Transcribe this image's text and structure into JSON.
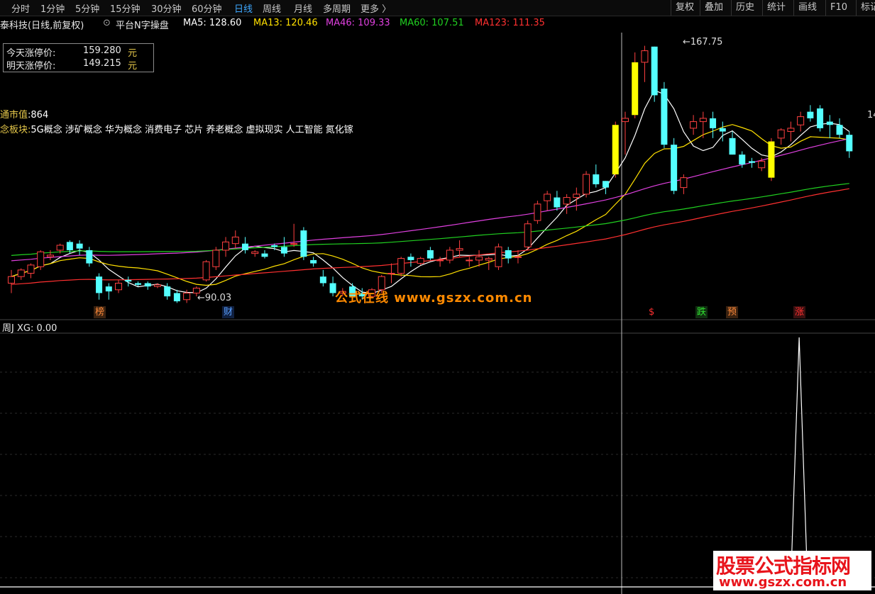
{
  "toolbar": {
    "periods": [
      "分时",
      "1分钟",
      "5分钟",
      "15分钟",
      "30分钟",
      "60分钟",
      "日线",
      "周线",
      "月线",
      "多周期",
      "更多 〉"
    ],
    "active_period": "日线",
    "tools": [
      "复权",
      "叠加",
      "历史",
      "统计",
      "画线",
      "F10",
      "标记"
    ]
  },
  "info": {
    "stock": "泰科技(日线,前复权)",
    "indicator": "平台N字操盘",
    "ma": [
      {
        "label": "MA5: 128.60",
        "color": "#ffffff"
      },
      {
        "label": "MA13: 120.46",
        "color": "#ffe000"
      },
      {
        "label": "MA46: 109.33",
        "color": "#e040e0"
      },
      {
        "label": "MA60: 107.51",
        "color": "#20d020"
      },
      {
        "label": "MA123: 111.35",
        "color": "#ff3030"
      }
    ]
  },
  "limits": {
    "today_label": "今天涨停价:",
    "today_value": "159.280",
    "tomorrow_label": "明天涨停价:",
    "tomorrow_value": "149.215",
    "unit": "元"
  },
  "notes": {
    "market_cap_label": "通市值",
    "market_cap_value": ":864",
    "concept_label": "念板块:",
    "concepts": "5G概念 涉矿概念 华为概念 消费电子 芯片 养老概念 虚拟现实 人工智能 氮化镓"
  },
  "annotations": {
    "high_label": "←167.75",
    "low_label": "←90.03",
    "right_edge_label": "14"
  },
  "watermark": "公式在线  www.gszx.com.cn",
  "signals": [
    {
      "text": "榜",
      "color": "#ff8a3a",
      "bg": "#3a2210"
    },
    {
      "text": "财",
      "color": "#5aa0ff",
      "bg": "#102040"
    },
    {
      "text": "$",
      "color": "#ff3030",
      "bg": "transparent"
    },
    {
      "text": "跌",
      "color": "#30e030",
      "bg": "#103010"
    },
    {
      "text": "预",
      "color": "#ff8a3a",
      "bg": "#3a2210"
    },
    {
      "text": "涨",
      "color": "#ff3030",
      "bg": "#3a1010"
    }
  ],
  "sub_indicator_label": "周J  XG: 0.00",
  "logo": {
    "title": "股票公式指标网",
    "url": "www.gszx.com.cn"
  },
  "chart_data": {
    "type": "candlestick",
    "y_unit": "price",
    "ylim": [
      86,
      172
    ],
    "candles": [
      [
        96,
        100,
        93,
        98
      ],
      [
        98,
        100.5,
        97,
        100
      ],
      [
        99,
        102,
        97.5,
        101.5
      ],
      [
        101,
        106,
        100,
        105.5
      ],
      [
        104,
        106,
        103,
        104.5
      ],
      [
        106,
        108,
        105,
        107.5
      ],
      [
        108.5,
        109,
        105,
        106
      ],
      [
        108,
        109,
        104.5,
        106.5
      ],
      [
        106,
        107,
        101,
        102
      ],
      [
        98,
        99,
        91,
        93
      ],
      [
        95,
        96,
        91,
        93.5
      ],
      [
        94,
        97,
        93,
        96
      ],
      [
        97,
        98,
        95,
        96.5
      ],
      [
        96,
        96.5,
        95,
        95.5
      ],
      [
        96,
        96.5,
        94,
        95
      ],
      [
        95,
        96,
        94.5,
        95.5
      ],
      [
        95,
        96,
        91,
        92
      ],
      [
        93,
        94,
        90,
        90.5
      ],
      [
        91,
        94,
        90,
        93
      ],
      [
        93,
        95,
        92,
        94.5
      ],
      [
        97,
        103,
        96.5,
        102.5
      ],
      [
        101,
        107,
        100,
        106
      ],
      [
        106,
        110,
        104,
        108.5
      ],
      [
        108,
        112,
        106.5,
        110
      ],
      [
        108,
        110,
        105,
        106
      ],
      [
        105,
        106,
        104,
        105.5
      ],
      [
        105,
        106,
        103.5,
        104
      ],
      [
        107.5,
        108,
        106,
        107
      ],
      [
        107,
        110,
        104,
        105
      ],
      [
        108,
        114,
        107,
        108
      ],
      [
        112,
        113,
        103,
        104
      ],
      [
        103,
        104,
        101,
        102
      ],
      [
        98,
        100,
        95,
        96
      ],
      [
        96,
        98,
        92,
        93
      ],
      [
        93,
        94.5,
        92,
        93.5
      ],
      [
        95,
        96,
        91,
        92
      ],
      [
        93,
        94.5,
        91,
        92
      ],
      [
        92,
        94.5,
        91.5,
        94
      ],
      [
        94,
        98.5,
        93,
        98
      ],
      [
        99,
        102,
        96,
        99
      ],
      [
        99,
        104,
        98,
        103.5
      ],
      [
        104,
        105,
        101,
        103
      ],
      [
        102,
        104,
        101.5,
        103.5
      ],
      [
        106,
        107,
        103,
        103.5
      ],
      [
        103,
        104,
        101,
        103
      ],
      [
        103,
        107,
        102,
        106
      ],
      [
        106,
        109,
        104,
        106.5
      ],
      [
        103,
        104,
        101,
        103
      ],
      [
        103,
        106,
        101,
        104
      ],
      [
        103,
        104,
        100,
        103.5
      ],
      [
        101,
        108,
        100,
        107
      ],
      [
        106,
        107,
        102,
        103.5
      ],
      [
        104,
        106,
        102,
        104
      ],
      [
        107,
        115,
        106,
        114
      ],
      [
        115,
        121,
        114,
        120
      ],
      [
        121,
        124,
        118,
        123
      ],
      [
        122,
        124,
        118,
        119
      ],
      [
        120,
        123,
        117,
        122
      ],
      [
        122,
        125,
        118,
        123
      ],
      [
        123,
        130,
        122,
        129
      ],
      [
        129,
        132,
        125,
        126
      ],
      [
        127,
        127,
        123,
        125
      ],
      [
        129,
        145,
        128,
        144
      ],
      [
        145,
        148,
        135,
        146
      ],
      [
        147,
        166,
        146,
        163
      ],
      [
        163,
        168,
        157,
        166.5
      ],
      [
        167.75,
        167.75,
        151,
        153
      ],
      [
        155,
        157,
        137,
        138
      ],
      [
        138,
        140,
        123,
        124
      ],
      [
        125,
        129,
        123,
        128
      ],
      [
        143,
        147,
        141,
        145
      ],
      [
        145,
        148,
        140,
        146
      ],
      [
        146,
        148,
        140,
        143
      ],
      [
        143,
        145,
        139,
        142
      ],
      [
        140,
        142,
        135,
        135
      ],
      [
        135,
        136,
        131,
        132
      ],
      [
        133,
        134,
        131,
        132.5
      ],
      [
        131,
        134,
        130,
        133
      ],
      [
        128,
        140,
        127,
        139
      ],
      [
        140,
        143,
        138,
        142.5
      ],
      [
        142,
        145,
        139,
        143
      ],
      [
        144,
        148,
        142,
        146.5
      ],
      [
        148,
        150,
        145,
        146
      ],
      [
        149,
        150,
        142,
        143
      ],
      [
        145,
        147,
        140,
        144
      ],
      [
        144,
        146,
        140,
        141
      ],
      [
        141,
        142,
        134,
        136
      ]
    ],
    "ma_series": [
      {
        "name": "MA5",
        "color": "#ffffff"
      },
      {
        "name": "MA13",
        "color": "#ffe000"
      },
      {
        "name": "MA46",
        "color": "#e040e0"
      },
      {
        "name": "MA60",
        "color": "#20d020"
      },
      {
        "name": "MA123",
        "color": "#ff3030"
      }
    ],
    "sub": {
      "series": "XG",
      "values_nonzero": [
        {
          "index": 81,
          "value": 1
        }
      ]
    }
  }
}
